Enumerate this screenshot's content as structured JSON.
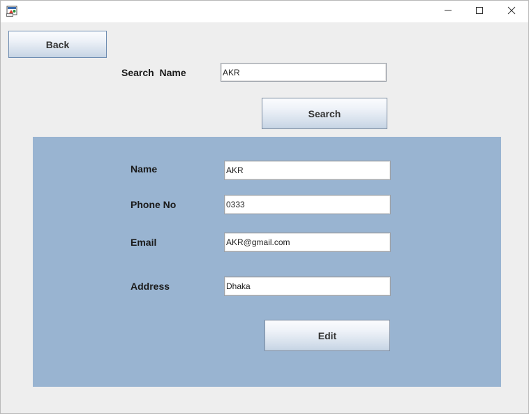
{
  "window": {
    "controls": {
      "minimize_icon": "minimize-icon",
      "maximize_icon": "maximize-icon",
      "close_icon": "close-icon"
    }
  },
  "toolbar": {
    "back_label": "Back"
  },
  "search": {
    "label": "Search  Name",
    "value": "AKR",
    "button_label": "Search"
  },
  "details": {
    "name_label": "Name",
    "name_value": "AKR",
    "phone_label": "Phone No",
    "phone_value": "0333",
    "email_label": "Email",
    "email_value": "AKR@gmail.com",
    "address_label": "Address",
    "address_value": "Dhaka",
    "edit_label": "Edit"
  },
  "colors": {
    "window_bg": "#eeeeee",
    "panel_bg": "#99b4d1",
    "button_border": "#7a8a9f"
  }
}
